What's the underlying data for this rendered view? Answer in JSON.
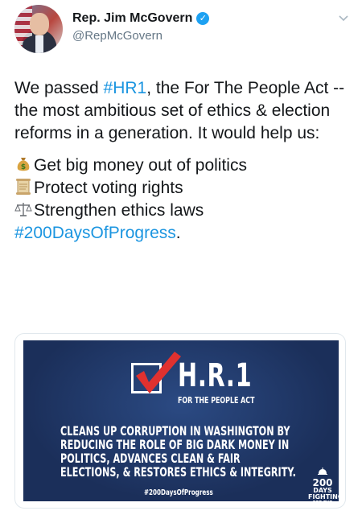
{
  "tweet": {
    "author": {
      "display_name": "Rep. Jim McGovern",
      "handle": "@RepMcGovern",
      "verified_icon": "verified-badge-icon"
    },
    "menu_icon": "chevron-down-icon",
    "text": {
      "p1_before": "We passed ",
      "p1_hashtag": "#HR1",
      "p1_after": ", the For The People Act -- the most ambitious set of ethics & election reforms in a generation. It would help us:",
      "items": [
        {
          "emoji": "money-bag-icon",
          "text": "Get big money out of politics"
        },
        {
          "emoji": "scroll-icon",
          "text": "Protect voting rights"
        },
        {
          "emoji": "balance-scale-icon",
          "text": "Strengthen ethics laws"
        }
      ],
      "closing_hashtag": "#200DaysOfProgress",
      "closing_punct": "."
    },
    "card": {
      "title": "H.R.1",
      "subtitle": "FOR THE PEOPLE ACT",
      "claim": "Cleans up corruption in Washington by reducing the role of big dark money in politics, advances clean & fair elections, & restores ethics & integrity.",
      "hashtag": "#200DaysOfProgress",
      "logo_number": "200",
      "logo_word1": "DAYS",
      "logo_word2": "FIGHTING",
      "logo_word3": "FOR THE PEOPLE"
    },
    "colors": {
      "link": "#1b95e0",
      "verified": "#1da1f2",
      "banner": "#1d3462",
      "check": "#e0312f"
    }
  }
}
